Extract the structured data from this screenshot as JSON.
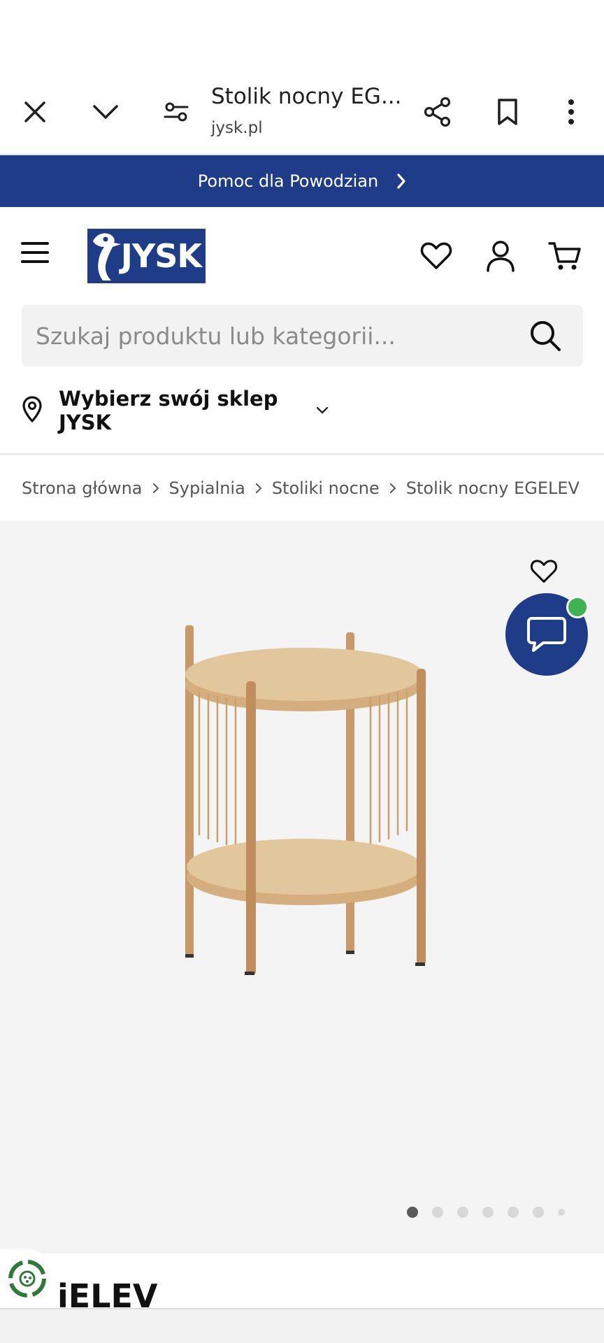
{
  "browser": {
    "title": "Stolik nocny EG...",
    "url": "jysk.pl",
    "icons": [
      "close-icon",
      "chevron-down-icon",
      "site-settings-icon",
      "share-icon",
      "bookmark-icon",
      "more-vert-icon"
    ]
  },
  "promo": {
    "text": "Pomoc dla Powodzian",
    "icon": "chevron-right-icon"
  },
  "header": {
    "logo_text": "JYSK",
    "icons": [
      "menu-icon",
      "heart-icon",
      "user-icon",
      "cart-icon"
    ]
  },
  "search": {
    "placeholder": "Szukaj produktu lub kategorii...",
    "value": ""
  },
  "store": {
    "label": "Wybierz swój sklep JYSK"
  },
  "breadcrumb": {
    "items": [
      "Strona główna",
      "Sypialnia",
      "Stoliki nocne",
      "Stolik nocny EGELEV"
    ]
  },
  "gallery": {
    "image_count": 7,
    "active_index": 0
  },
  "product": {
    "title_visible": "iELEV"
  },
  "colors": {
    "brand_blue": "#1f3c88",
    "online_green": "#3fb34f",
    "wood": "#d9b98a"
  }
}
